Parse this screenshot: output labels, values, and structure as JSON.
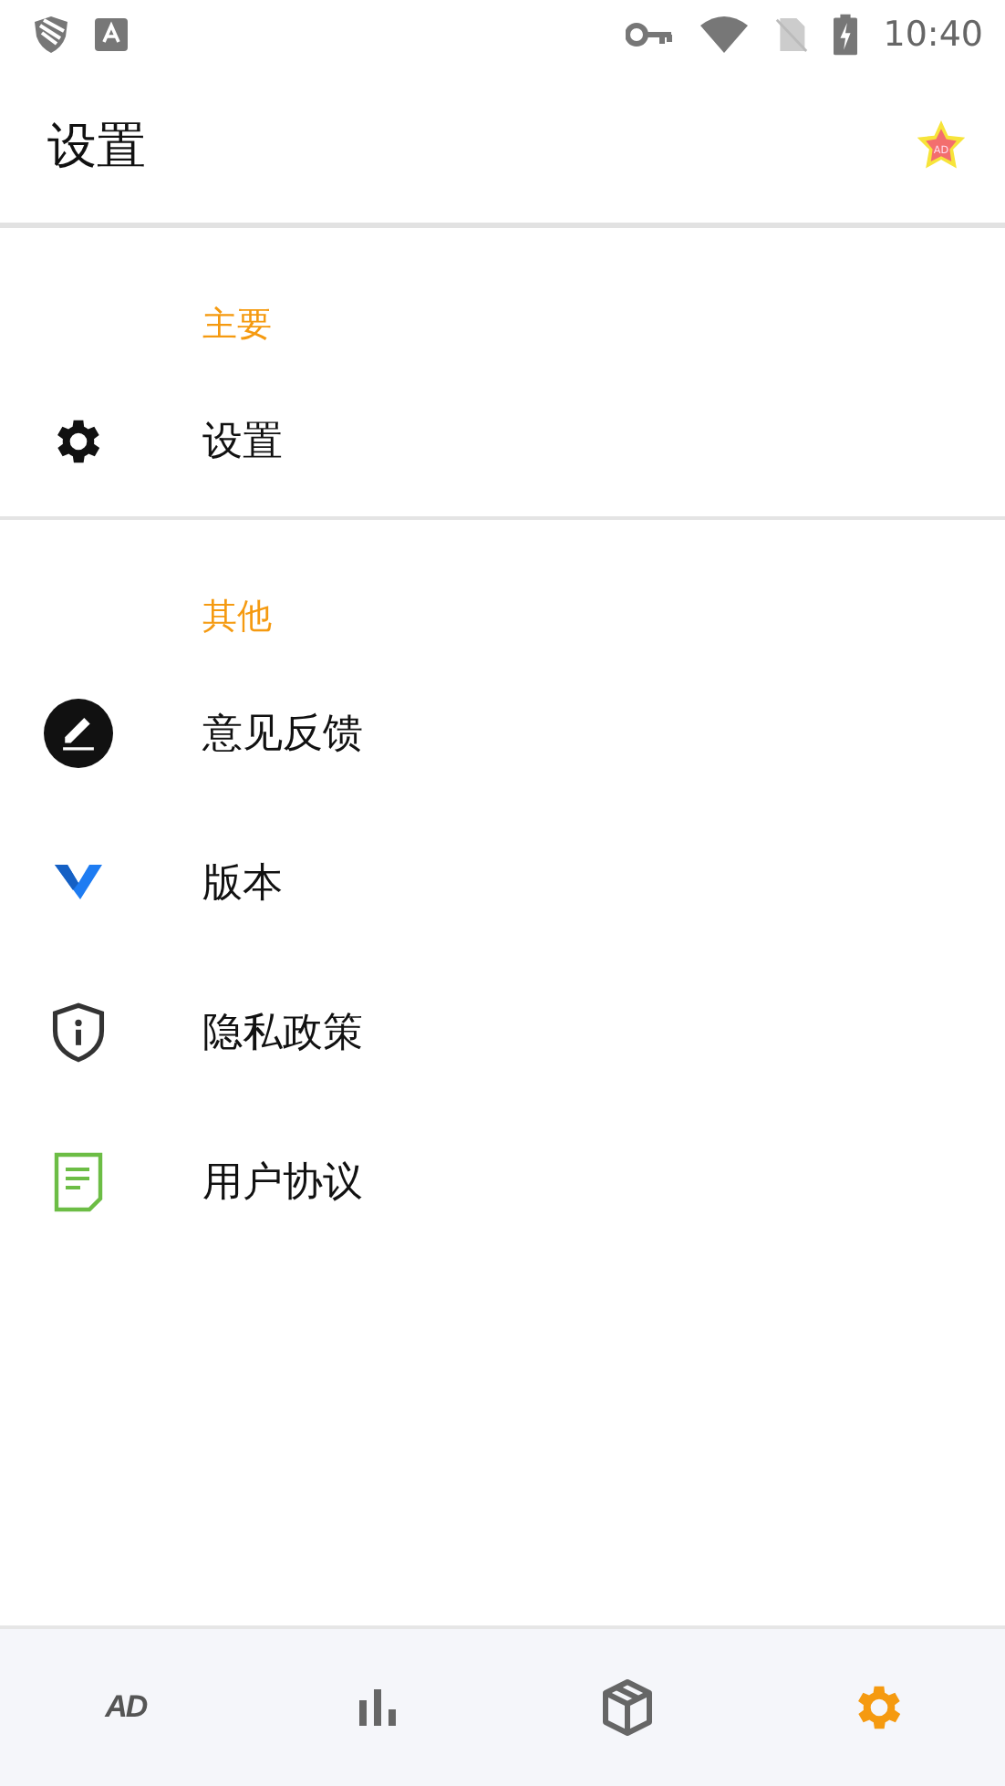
{
  "status_bar": {
    "time": "10:40"
  },
  "header": {
    "title": "设置",
    "badge_text": "AD"
  },
  "sections": [
    {
      "title": "主要",
      "items": [
        {
          "label": "设置",
          "kind": "gear"
        }
      ]
    },
    {
      "title": "其他",
      "items": [
        {
          "label": "意见反馈",
          "kind": "edit"
        },
        {
          "label": "版本",
          "kind": "version"
        },
        {
          "label": "隐私政策",
          "kind": "shield"
        },
        {
          "label": "用户协议",
          "kind": "document"
        }
      ]
    }
  ],
  "bottom_nav": [
    {
      "kind": "ad",
      "label": "AD",
      "selected": false
    },
    {
      "kind": "chart",
      "selected": false
    },
    {
      "kind": "box",
      "selected": false
    },
    {
      "kind": "gear",
      "selected": true
    }
  ]
}
